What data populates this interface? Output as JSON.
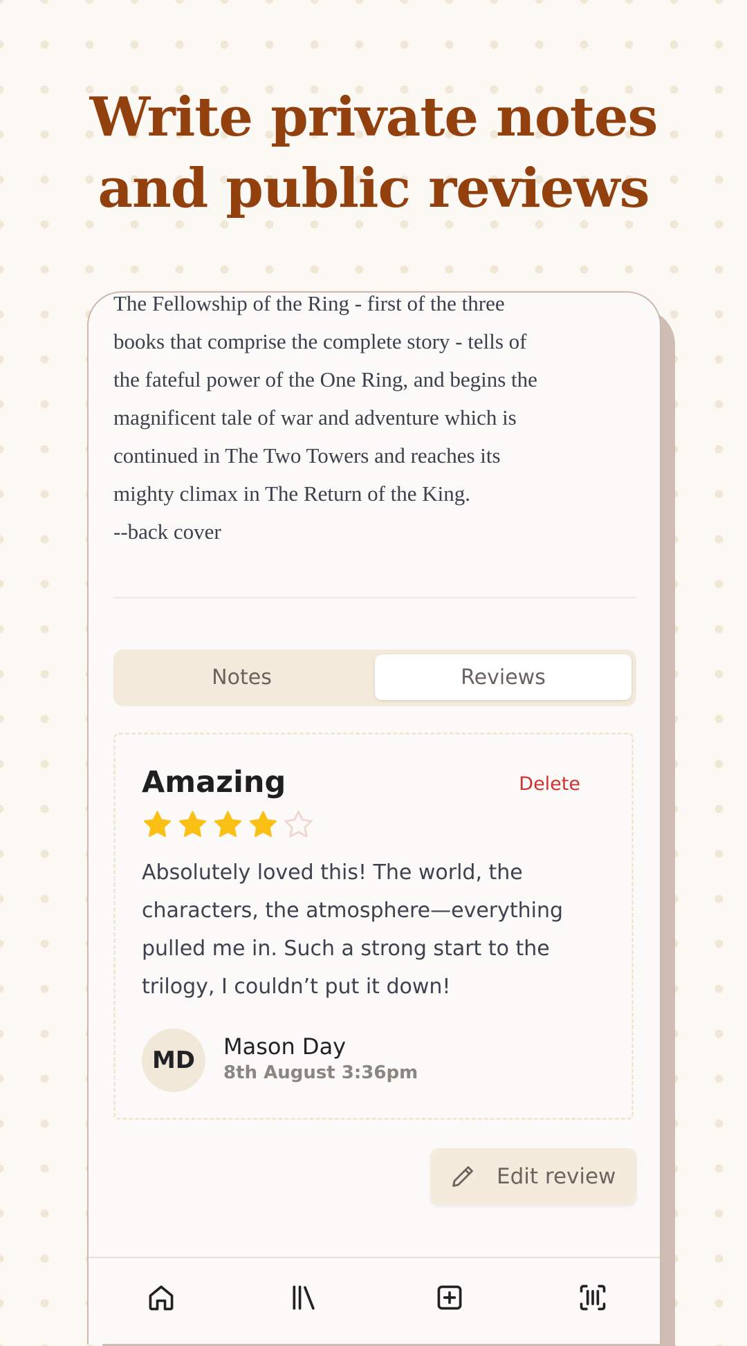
{
  "headline": {
    "line1": "Write private notes",
    "line2": "and public reviews"
  },
  "book": {
    "description_lines": [
      "The Fellowship of the Ring - first of the three",
      "books that comprise the complete story - tells of",
      "the fateful power of the One Ring, and begins the",
      "magnificent tale of war and adventure which is",
      "continued in The Two Towers and reaches its",
      "mighty climax in The Return of the King.",
      "--back cover"
    ]
  },
  "tabs": {
    "notes_label": "Notes",
    "reviews_label": "Reviews",
    "selected": "Reviews"
  },
  "review": {
    "title": "Amazing",
    "delete_label": "Delete",
    "rating": 4,
    "rating_max": 5,
    "body": "Absolutely loved this! The world, the characters, the atmosphere—everything pulled me in. Such a strong start to the trilogy, I couldn’t put it down!",
    "author_initials": "MD",
    "author_name": "Mason Day",
    "date": "8th August 3:36pm"
  },
  "edit_button": {
    "label": "Edit review",
    "icon": "pencil-icon"
  },
  "bottom_nav": {
    "items": [
      "home-icon",
      "library-icon",
      "add-book-icon",
      "scan-barcode-icon"
    ]
  },
  "colors": {
    "headline": "#92400e",
    "star_filled": "#fbc015",
    "star_empty": "#f0d8d0",
    "delete": "#cf3030",
    "tab_bg": "#f3eadb",
    "background": "#fcf9f5"
  }
}
